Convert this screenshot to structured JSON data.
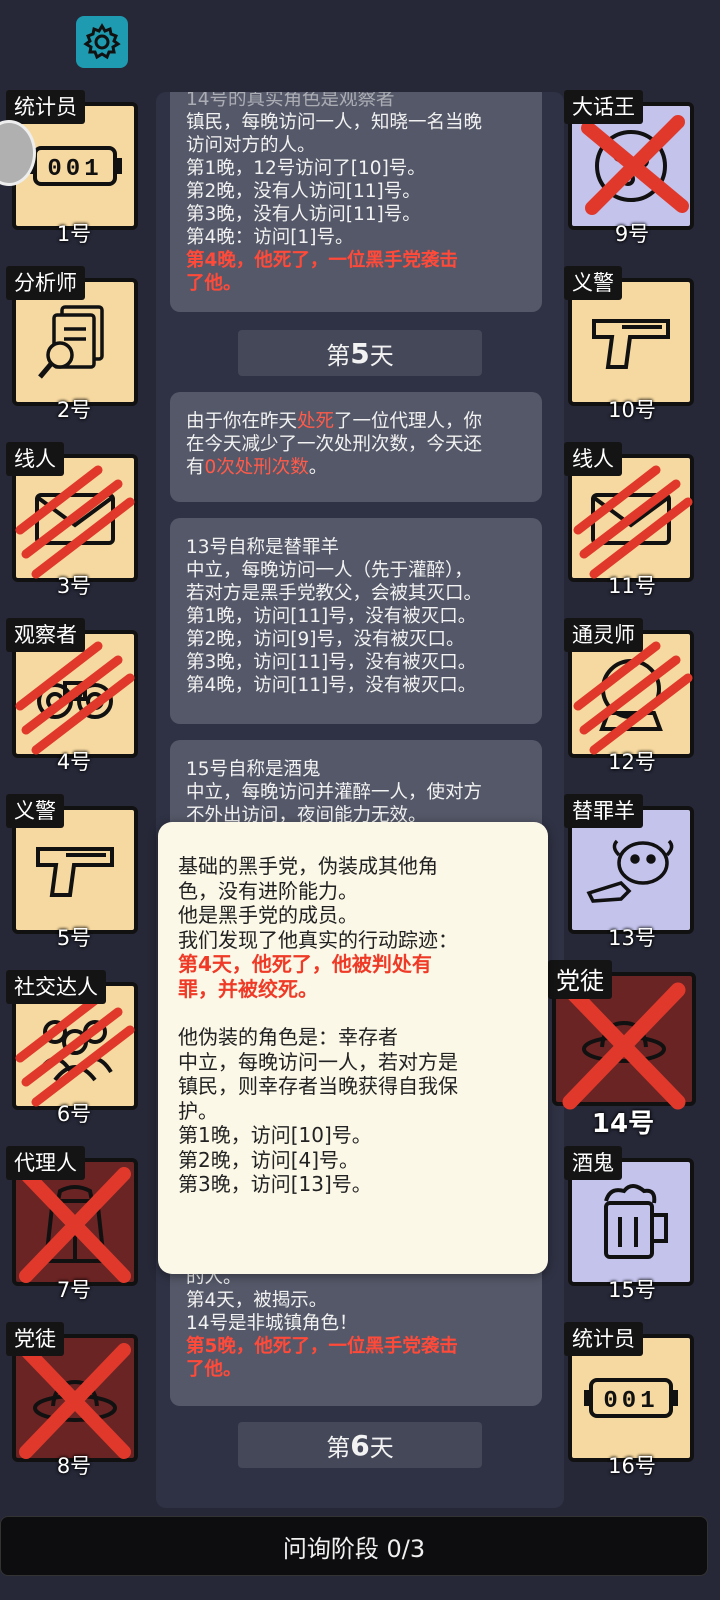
{
  "header": {
    "settings_icon": "gear-icon"
  },
  "log": {
    "entry1_top": "14号的真实角色是观察者",
    "entry1_lines": [
      "镇民，每晚访问一人，知晓一名当晚",
      "访问对方的人。",
      "第1晚，12号访问了[10]号。",
      "第2晚，没有人访问[11]号。",
      "第3晚，没有人访问[11]号。",
      "第4晚：访问[1]号。"
    ],
    "entry1_death": [
      "第4晚，他死了，一位黑手党袭击",
      "了他。"
    ],
    "day5_prefix": "第",
    "day5_num": "5",
    "day5_suffix": "天",
    "entry2_a": "由于你在昨天",
    "entry2_b": "处死",
    "entry2_c": "了一位代理人，你",
    "entry2_d": "在今天减少了一次处刑次数，今天还",
    "entry2_e": "有",
    "entry2_f": "0次处刑次数",
    "entry2_g": "。",
    "entry3_lines": [
      "13号自称是替罪羊",
      "中立，每晚访问一人（先于灌醉），",
      "若对方是黑手党教父，会被其灭口。",
      "第1晚，访问[11]号，没有被灭口。",
      "第2晚，访问[9]号，没有被灭口。",
      "第3晚，访问[11]号，没有被灭口。",
      "第4晚，访问[11]号，没有被灭口。"
    ],
    "entry4_lines": [
      "15号自称是酒鬼",
      "中立，每晚访问并灌醉一人，使对方",
      "不外出访问，夜间能力无效。"
    ],
    "entry5_lines": [
      "的人。",
      "第4天，被揭示。",
      "14号是非城镇角色！"
    ],
    "entry5_death": [
      "第5晚，他死了，一位黑手党袭击",
      "了他。"
    ],
    "day6_prefix": "第",
    "day6_num": "6",
    "day6_suffix": "天"
  },
  "popup": {
    "lines": [
      "基础的黑手党，伪装成其他角",
      "色，没有进阶能力。",
      "他是黑手党的成员。",
      "我们发现了他真实的行动踪迹："
    ],
    "red_lines": [
      "第4天，他死了，他被判处有",
      "罪，并被绞死。"
    ],
    "lines2": [
      "他伪装的角色是：幸存者",
      "中立，每晚访问一人，若对方是",
      "镇民，则幸存者当晚获得自我保",
      "护。",
      "第1晚，访问[10]号。",
      "第2晚，访问[4]号。",
      "第3晚，访问[13]号。"
    ]
  },
  "left_players": [
    {
      "role": "统计员",
      "number": "1号",
      "status": "alive",
      "icon": "counter-icon"
    },
    {
      "role": "分析师",
      "number": "2号",
      "status": "alive",
      "icon": "documents-magnifier-icon"
    },
    {
      "role": "线人",
      "number": "3号",
      "status": "clawed",
      "icon": "envelope-icon"
    },
    {
      "role": "观察者",
      "number": "4号",
      "status": "clawed",
      "icon": "binoculars-icon"
    },
    {
      "role": "义警",
      "number": "5号",
      "status": "alive",
      "icon": "pistol-icon"
    },
    {
      "role": "社交达人",
      "number": "6号",
      "status": "clawed",
      "icon": "people-icon"
    },
    {
      "role": "代理人",
      "number": "7号",
      "status": "crossed",
      "icon": "agent-coat-icon"
    },
    {
      "role": "党徒",
      "number": "8号",
      "status": "crossed",
      "icon": "hat-icon"
    }
  ],
  "right_players": [
    {
      "role": "大话王",
      "number": "9号",
      "status": "crossed",
      "icon": "pizza-icon"
    },
    {
      "role": "义警",
      "number": "10号",
      "status": "alive",
      "icon": "pistol-icon"
    },
    {
      "role": "线人",
      "number": "11号",
      "status": "clawed",
      "icon": "envelope-icon"
    },
    {
      "role": "通灵师",
      "number": "12号",
      "status": "clawed",
      "icon": "crystal-ball-icon"
    },
    {
      "role": "替罪羊",
      "number": "13号",
      "status": "alive",
      "icon": "sheep-icon"
    },
    {
      "role": "党徒",
      "number": "14号",
      "status": "crossed",
      "icon": "hat-icon"
    },
    {
      "role": "酒鬼",
      "number": "15号",
      "status": "alive",
      "icon": "beer-mug-icon"
    },
    {
      "role": "统计员",
      "number": "16号",
      "status": "alive",
      "icon": "counter-icon"
    }
  ],
  "counter_digits": "001",
  "bottom_bar": {
    "label": "问询阶段 0/3"
  }
}
